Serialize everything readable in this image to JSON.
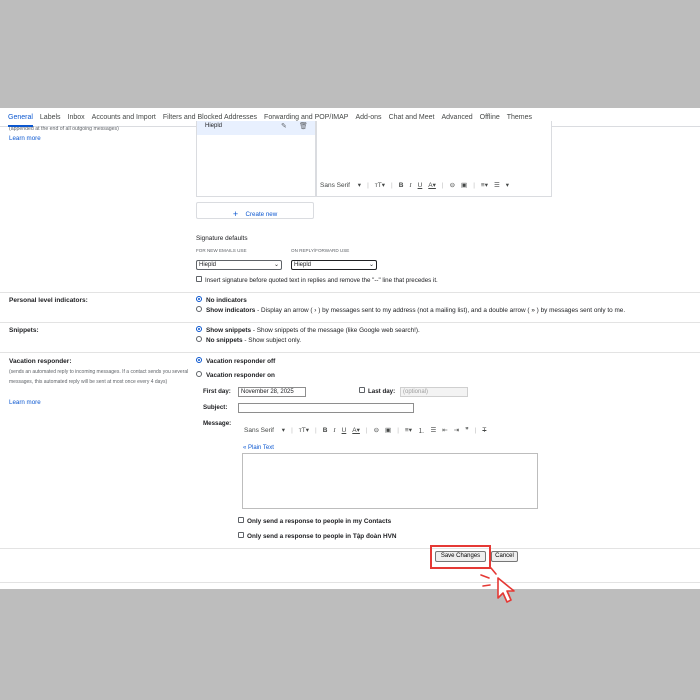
{
  "tabs": [
    "General",
    "Labels",
    "Inbox",
    "Accounts and Import",
    "Filters and Blocked Addresses",
    "Forwarding and POP/IMAP",
    "Add-ons",
    "Chat and Meet",
    "Advanced",
    "Offline",
    "Themes"
  ],
  "signature": {
    "note": "(appended at the end of all outgoing messages)",
    "learn_more": "Learn more",
    "item_name": "Hiepld",
    "toolbar_font": "Sans Serif",
    "create_new": "Create new",
    "defaults_title": "Signature defaults",
    "new_emails_label": "FOR NEW EMAILS USE",
    "new_emails_value": "Hiepld",
    "reply_label": "ON REPLY/FORWARD USE",
    "reply_value": "Hiepld",
    "insert_before": "Insert signature before quoted text in replies and remove the \"--\" line that precedes it."
  },
  "personal": {
    "label": "Personal level indicators:",
    "opt1": "No indicators",
    "opt2_bold": "Show indicators",
    "opt2_rest": " - Display an arrow ( › ) by messages sent to my address (not a mailing list), and a double arrow ( » ) by messages sent only to me."
  },
  "snippets": {
    "label": "Snippets:",
    "opt1_bold": "Show snippets",
    "opt1_rest": " - Show snippets of the message (like Google web search!).",
    "opt2_bold": "No snippets",
    "opt2_rest": " - Show subject only."
  },
  "vacation": {
    "label": "Vacation responder:",
    "desc": "(sends an automated reply to incoming messages. If a contact sends you several messages, this automated reply will be sent at most once every 4 days)",
    "learn_more": "Learn more",
    "off": "Vacation responder off",
    "on": "Vacation responder on",
    "first_day_label": "First day:",
    "first_day_value": "November 28, 2025",
    "last_day_label": "Last day:",
    "last_day_placeholder": "(optional)",
    "subject_label": "Subject:",
    "message_label": "Message:",
    "toolbar_font": "Sans Serif",
    "plain_text": "« Plain Text",
    "only_contacts": "Only send a response to people in my Contacts",
    "only_org": "Only send a response to people in Tập đoàn HVN"
  },
  "actions": {
    "save": "Save Changes",
    "cancel": "Cancel"
  },
  "colors": {
    "accent": "#0b57d0",
    "highlight": "#e53935"
  }
}
